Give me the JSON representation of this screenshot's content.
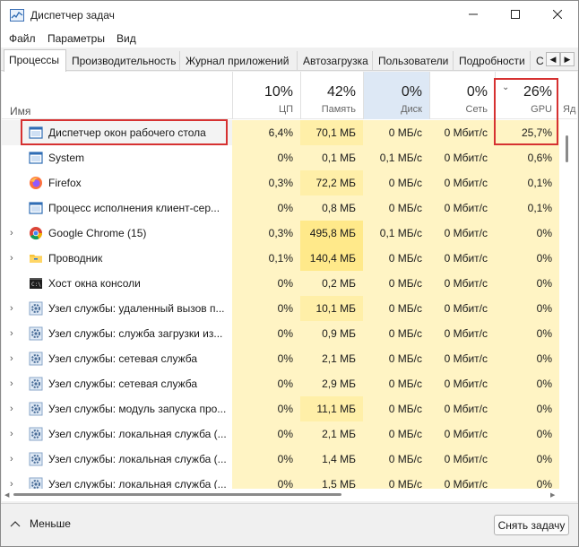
{
  "window": {
    "title": "Диспетчер задач",
    "controls": {
      "minimize": "minimize-icon",
      "maximize": "maximize-icon",
      "close": "close-icon"
    }
  },
  "menu": [
    "Файл",
    "Параметры",
    "Вид"
  ],
  "tabs": [
    "Процессы",
    "Производительность",
    "Журнал приложений",
    "Автозагрузка",
    "Пользователи",
    "Подробности",
    "С"
  ],
  "active_tab": "Процессы",
  "table": {
    "name_header": "Имя",
    "columns": [
      {
        "key": "cpu",
        "pct": "10%",
        "label": "ЦП"
      },
      {
        "key": "mem",
        "pct": "42%",
        "label": "Память"
      },
      {
        "key": "disk",
        "pct": "0%",
        "label": "Диск"
      },
      {
        "key": "net",
        "pct": "0%",
        "label": "Сеть"
      },
      {
        "key": "gpu",
        "pct": "26%",
        "label": "GPU"
      }
    ],
    "extra_column_partial": "Яд",
    "rows": [
      {
        "name": "Диспетчер окон рабочего стола",
        "icon": "window-manager-icon",
        "expandable": false,
        "cpu": "6,4%",
        "mem": "70,1 МБ",
        "disk": "0 МБ/с",
        "net": "0 Мбит/с",
        "gpu": "25,7%"
      },
      {
        "name": "System",
        "icon": "system-icon",
        "expandable": false,
        "cpu": "0%",
        "mem": "0,1 МБ",
        "disk": "0,1 МБ/с",
        "net": "0 Мбит/с",
        "gpu": "0,6%"
      },
      {
        "name": "Firefox",
        "icon": "firefox-icon",
        "expandable": false,
        "cpu": "0,3%",
        "mem": "72,2 МБ",
        "disk": "0 МБ/с",
        "net": "0 Мбит/с",
        "gpu": "0,1%"
      },
      {
        "name": "Процесс исполнения клиент-сер...",
        "icon": "client-server-runtime-icon",
        "expandable": false,
        "cpu": "0%",
        "mem": "0,8 МБ",
        "disk": "0 МБ/с",
        "net": "0 Мбит/с",
        "gpu": "0,1%"
      },
      {
        "name": "Google Chrome (15)",
        "icon": "chrome-icon",
        "expandable": true,
        "cpu": "0,3%",
        "mem": "495,8 МБ",
        "disk": "0,1 МБ/с",
        "net": "0 Мбит/с",
        "gpu": "0%"
      },
      {
        "name": "Проводник",
        "icon": "explorer-folder-icon",
        "expandable": true,
        "cpu": "0,1%",
        "mem": "140,4 МБ",
        "disk": "0 МБ/с",
        "net": "0 Мбит/с",
        "gpu": "0%"
      },
      {
        "name": "Хост окна консоли",
        "icon": "console-icon",
        "expandable": false,
        "cpu": "0%",
        "mem": "0,2 МБ",
        "disk": "0 МБ/с",
        "net": "0 Мбит/с",
        "gpu": "0%"
      },
      {
        "name": "Узел службы: удаленный вызов п...",
        "icon": "service-gear-icon",
        "expandable": true,
        "cpu": "0%",
        "mem": "10,1 МБ",
        "disk": "0 МБ/с",
        "net": "0 Мбит/с",
        "gpu": "0%"
      },
      {
        "name": "Узел службы: служба загрузки из...",
        "icon": "service-gear-icon",
        "expandable": true,
        "cpu": "0%",
        "mem": "0,9 МБ",
        "disk": "0 МБ/с",
        "net": "0 Мбит/с",
        "gpu": "0%"
      },
      {
        "name": "Узел службы: сетевая служба",
        "icon": "service-gear-icon",
        "expandable": true,
        "cpu": "0%",
        "mem": "2,1 МБ",
        "disk": "0 МБ/с",
        "net": "0 Мбит/с",
        "gpu": "0%"
      },
      {
        "name": "Узел службы: сетевая служба",
        "icon": "service-gear-icon",
        "expandable": true,
        "cpu": "0%",
        "mem": "2,9 МБ",
        "disk": "0 МБ/с",
        "net": "0 Мбит/с",
        "gpu": "0%"
      },
      {
        "name": "Узел службы: модуль запуска про...",
        "icon": "service-gear-icon",
        "expandable": true,
        "cpu": "0%",
        "mem": "11,1 МБ",
        "disk": "0 МБ/с",
        "net": "0 Мбит/с",
        "gpu": "0%"
      },
      {
        "name": "Узел службы: локальная служба (...",
        "icon": "service-gear-icon",
        "expandable": true,
        "cpu": "0%",
        "mem": "2,1 МБ",
        "disk": "0 МБ/с",
        "net": "0 Мбит/с",
        "gpu": "0%"
      },
      {
        "name": "Узел службы: локальная служба (...",
        "icon": "service-gear-icon",
        "expandable": true,
        "cpu": "0%",
        "mem": "1,4 МБ",
        "disk": "0 МБ/с",
        "net": "0 Мбит/с",
        "gpu": "0%"
      },
      {
        "name": "Узел службы: локальная служба (...",
        "icon": "service-gear-icon",
        "expandable": true,
        "cpu": "0%",
        "mem": "1,5 МБ",
        "disk": "0 МБ/с",
        "net": "0 Мбит/с",
        "gpu": "0%"
      }
    ]
  },
  "footer": {
    "less_label": "Меньше",
    "end_task_label": "Снять задачу"
  },
  "colors": {
    "highlight_border": "#d63131",
    "heat_light": "#fff4c4",
    "heat_mid": "#ffefa8",
    "heat_dark": "#ffe98a",
    "disk_header": "#dde8f5"
  }
}
